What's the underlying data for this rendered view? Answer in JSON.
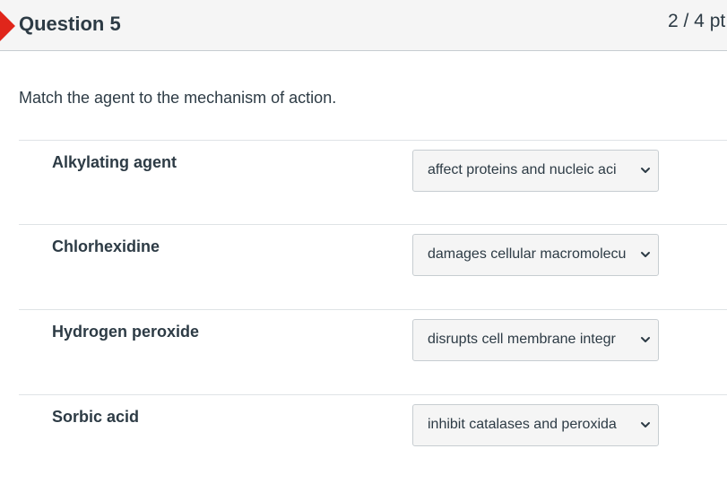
{
  "question": {
    "title": "Question 5",
    "points": "2 / 4 pt"
  },
  "prompt": "Match the agent to the mechanism of action.",
  "matches": [
    {
      "agent": "Alkylating agent",
      "selected": "affect proteins and nucleic aci"
    },
    {
      "agent": "Chlorhexidine",
      "selected": "damages cellular macromolecu"
    },
    {
      "agent": "Hydrogen peroxide",
      "selected": "disrupts cell membrane integr"
    },
    {
      "agent": "Sorbic acid",
      "selected": "inhibit catalases and peroxida"
    }
  ],
  "icons": {
    "flag": "flag-icon",
    "dropdown": "chevron-down-icon"
  },
  "colors": {
    "flag": "#e0261b",
    "header_bg": "#f5f5f5",
    "text": "#2d3b45"
  }
}
